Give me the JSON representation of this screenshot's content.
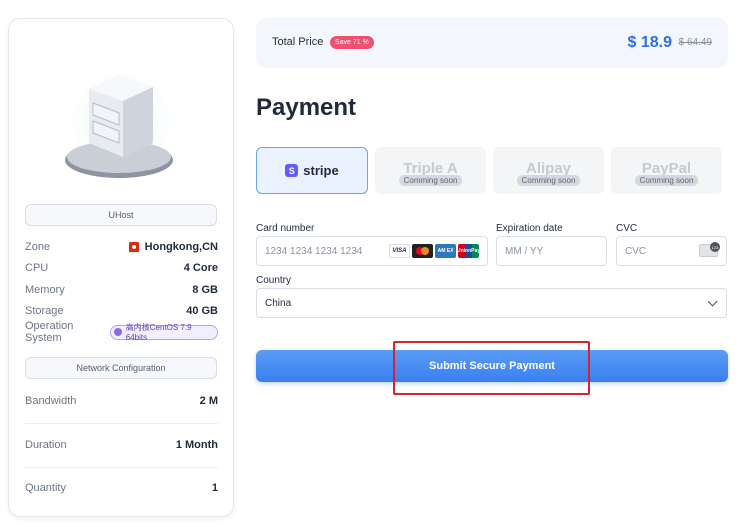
{
  "left": {
    "product_name": "UHost",
    "specs": {
      "zone_label": "Zone",
      "zone_value": "Hongkong,CN",
      "cpu_label": "CPU",
      "cpu_value": "4 Core",
      "memory_label": "Memory",
      "memory_value": "8 GB",
      "storage_label": "Storage",
      "storage_value": "40 GB",
      "os_label": "Operation System",
      "os_value": "高内核CentOS 7.9 64bits"
    },
    "network_title": "Network Configuration",
    "bandwidth_label": "Bandwidth",
    "bandwidth_value": "2 M",
    "duration_label": "Duration",
    "duration_value": "1 Month",
    "quantity_label": "Quantity",
    "quantity_value": "1"
  },
  "price": {
    "label": "Total Price",
    "save_badge": "Save 71 %",
    "current": "$ 18.9",
    "original": "$ 64.49"
  },
  "payment": {
    "title": "Payment",
    "methods": [
      {
        "name": "stripe"
      },
      {
        "name": "Triple A",
        "status": "Comming soon"
      },
      {
        "name": "Alipay",
        "status": "Comming soon"
      },
      {
        "name": "PayPal",
        "status": "Comming soon"
      }
    ],
    "card_number_label": "Card number",
    "card_number_placeholder": "1234 1234 1234 1234",
    "card_brands": {
      "visa": "VISA",
      "amex": "AM EX",
      "unionpay": "UnionPay"
    },
    "expiration_label": "Expiration date",
    "expiration_placeholder": "MM / YY",
    "cvc_label": "CVC",
    "cvc_placeholder": "CVC",
    "country_label": "Country",
    "country_value": "China",
    "submit_label": "Submit Secure Payment"
  },
  "colors": {
    "accent": "#3a7ff0",
    "price": "#2f6fe0",
    "save_badge": "#f0506e",
    "highlight": "#d6252a"
  }
}
